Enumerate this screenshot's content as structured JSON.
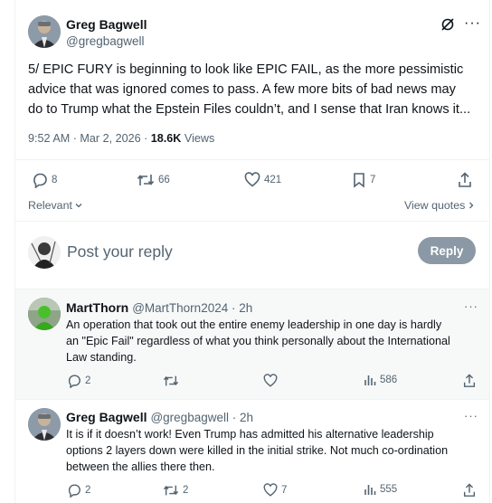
{
  "main_tweet": {
    "author_name": "Greg Bagwell",
    "author_handle": "@gregbagwell",
    "text_lines": [
      "5/ EPIC FURY is beginning to look like EPIC FAIL, as the more pessimistic",
      "advice that was ignored comes to pass. A few more bits of bad news may",
      "do to Trump what the Epstein Files couldn’t, and I sense that Iran knows it..."
    ],
    "timestamp": "9:52 AM · Mar 2, 2026 · ",
    "views_count": "18.6K",
    "views_label": " Views",
    "replies": "8",
    "reposts": "66",
    "likes": "421",
    "bookmarks": "7",
    "more_icon": "ellipsis-icon",
    "grok_icon": "grok-icon"
  },
  "sort": {
    "label": "Relevant",
    "view_quotes": "View quotes"
  },
  "composer": {
    "placeholder": "Post your reply",
    "reply_button": "Reply"
  },
  "replies": [
    {
      "author_name": "MartThorn",
      "author_handle": "@MartThorn2024 · 2h",
      "text_lines": [
        "An operation that took out the entire enemy leadership in one day is hardly",
        "an \"Epic Fail\" regardless of what you think personally about the International",
        "Law standing."
      ],
      "replies": "2",
      "reposts": "",
      "likes": "",
      "views": "586"
    },
    {
      "author_name": "Greg Bagwell",
      "author_handle": "@gregbagwell · 2h",
      "text_lines": [
        "It is if it doesn’t work! Even Trump has admitted his alternative leadership",
        "options 2 layers down were killed in the initial strike. Not much co-ordination",
        "between the allies there then."
      ],
      "replies": "2",
      "reposts": "2",
      "likes": "7",
      "views": "555"
    }
  ],
  "colors": {
    "text": "#0f1419",
    "muted": "#536471",
    "divider": "#eff3f4",
    "reply_button": "#8b98a5",
    "highlight_row": "#f7f9f9"
  }
}
